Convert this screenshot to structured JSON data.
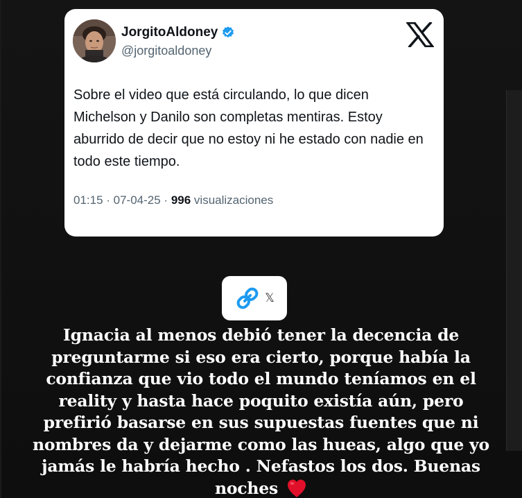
{
  "tweet": {
    "author_name": "JorgitoAldoney",
    "author_handle": "@jorgitoaldoney",
    "verified_icon": "verified-badge-icon",
    "platform_icon": "x-logo-icon",
    "text": "Sobre el video que está circulando, lo que dicen Michelson y Danilo son completas mentiras. Estoy aburrido de decir que no estoy ni he estado con nadie en todo este tiempo.",
    "time_date": "01:15 · 07-04-25 · ",
    "views_count": "996",
    "views_label": " visualizaciones"
  },
  "link_sticker": {
    "icon": "link-icon",
    "label": "𝕏"
  },
  "caption": {
    "text": "Ignacia al menos debió tener la decencia de preguntarme si eso era cierto, porque había la confianza que vio todo el mundo teníamos en el reality y hasta hace poquito existía aún, pero prefirió basarse en sus supuestas fuentes que ni nombres da y dejarme como las hueas, algo que yo jamás le habría hecho . Nefastos los dos. Buenas noches",
    "emoji_icon": "red-heart-icon"
  },
  "colors": {
    "background": "#111111",
    "card": "#ffffff",
    "verified_blue": "#1d9bf0",
    "handle_gray": "#536471",
    "link_blue": "#1d9bf0",
    "heart_red": "#e0102a"
  }
}
